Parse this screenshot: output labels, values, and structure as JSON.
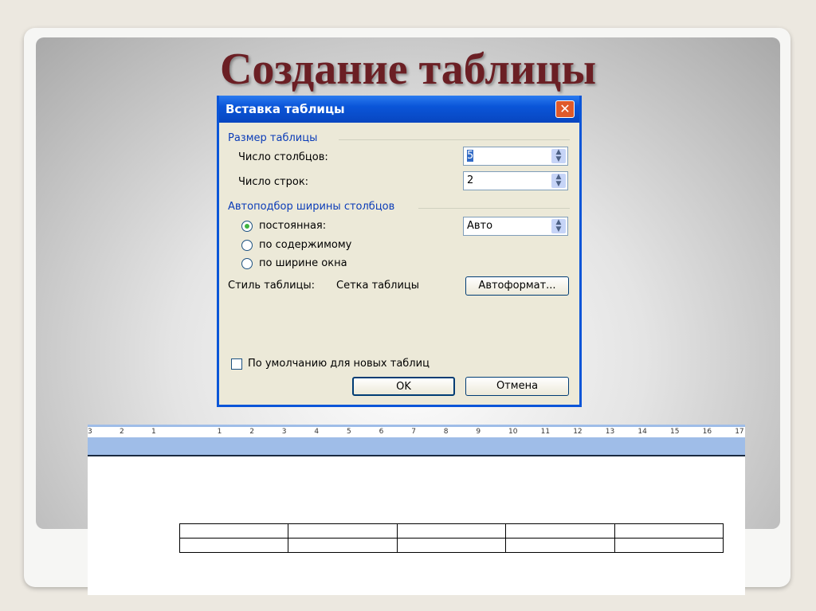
{
  "slide_title": "Создание таблицы",
  "dialog": {
    "title": "Вставка таблицы",
    "size_group": "Размер таблицы",
    "cols_label": "Число столбцов:",
    "cols_value": "5",
    "rows_label": "Число строк:",
    "rows_value": "2",
    "autofit_group": "Автоподбор ширины столбцов",
    "radio_fixed": "постоянная:",
    "fixed_value": "Авто",
    "radio_content": "по содержимому",
    "radio_window": "по ширине окна",
    "style_label": "Стиль таблицы:",
    "style_value": "Сетка таблицы",
    "autoformat": "Автоформат...",
    "default_check": "По умолчанию для новых таблиц",
    "ok": "OK",
    "cancel": "Отмена",
    "close": "✕"
  },
  "ruler": [
    "3",
    "2",
    "1",
    "1",
    "2",
    "3",
    "4",
    "5",
    "6",
    "7",
    "8",
    "9",
    "10",
    "11",
    "12",
    "13",
    "14",
    "15",
    "16",
    "17"
  ],
  "table": {
    "rows": 2,
    "cols": 5
  }
}
